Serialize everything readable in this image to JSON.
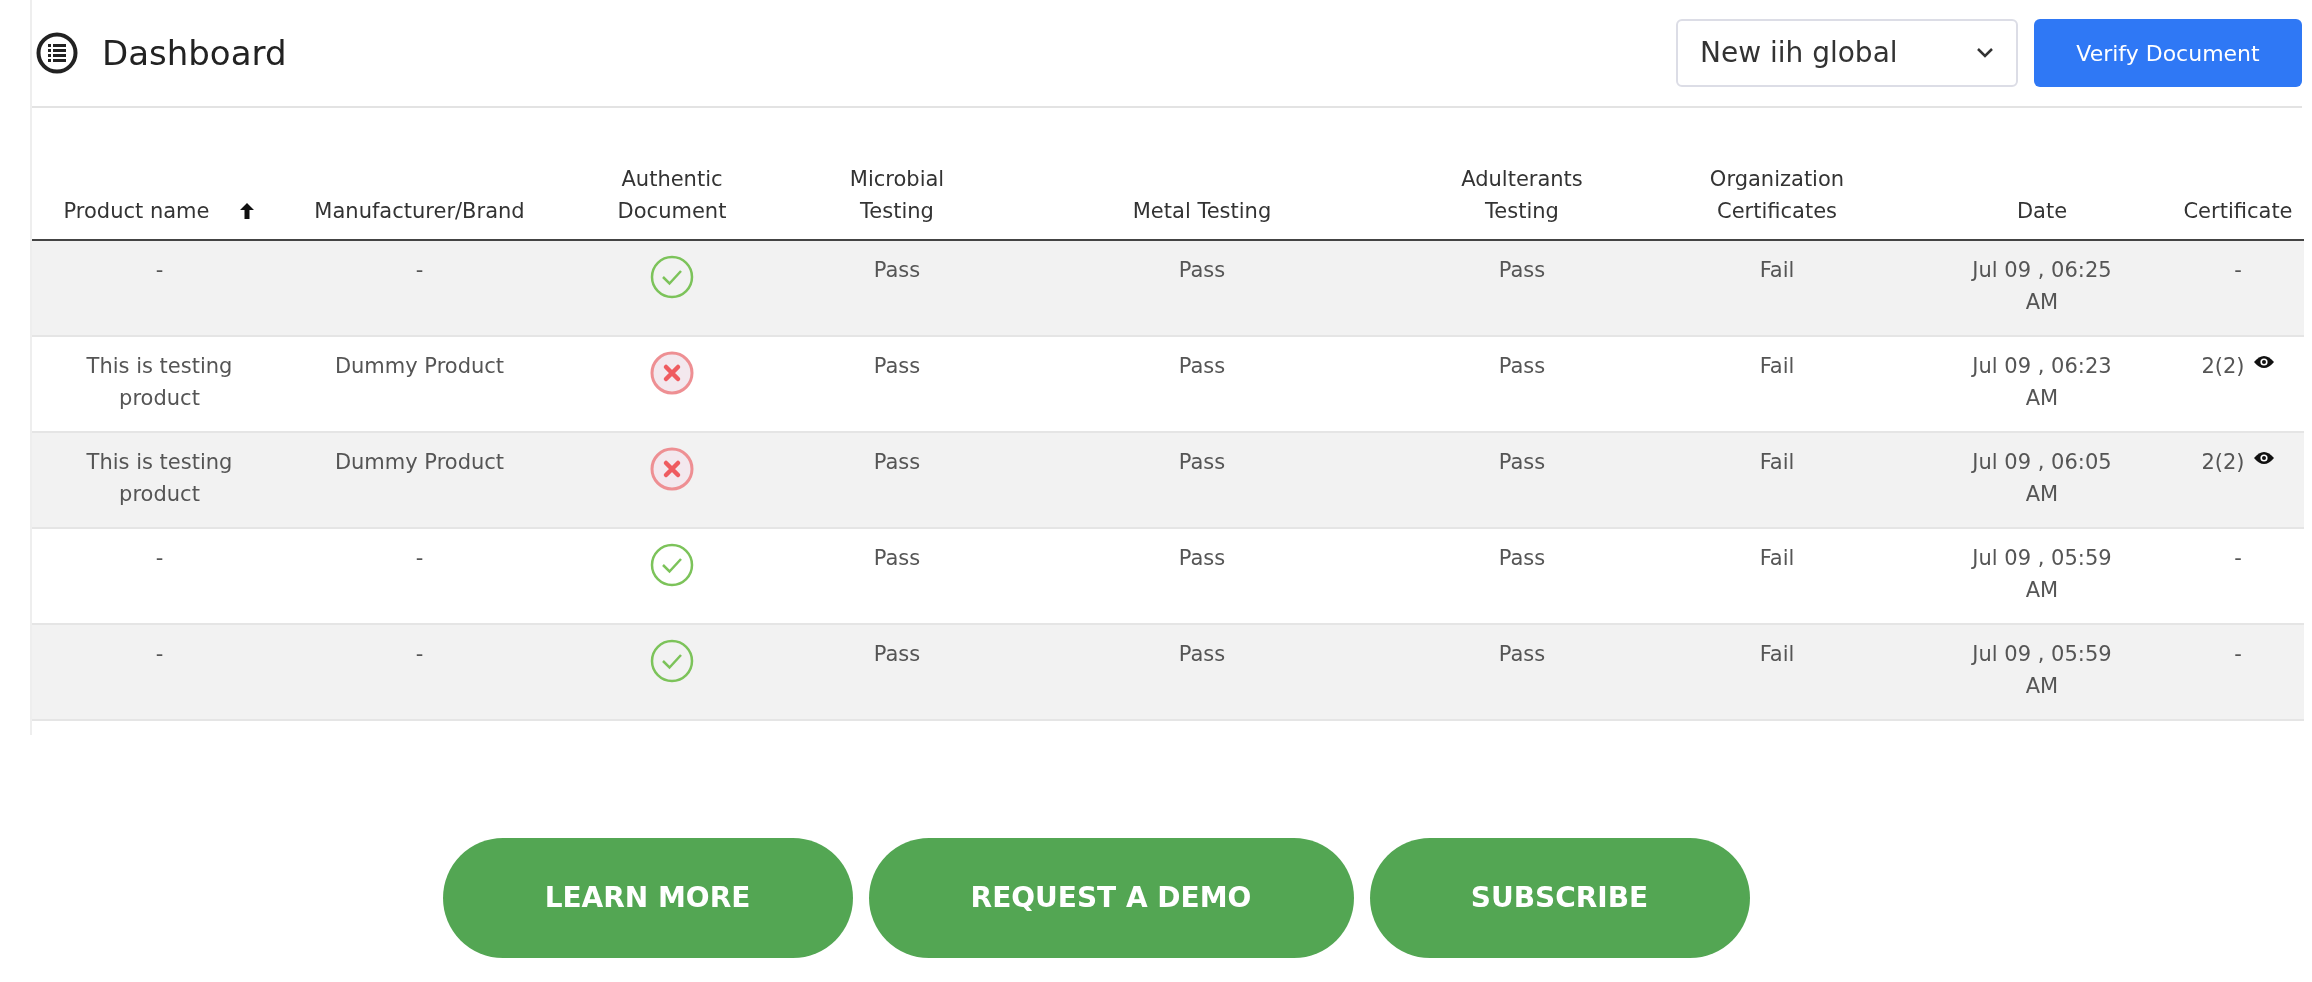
{
  "header": {
    "title": "Dashboard",
    "organization_select": {
      "value": "New iih global"
    },
    "verify_button": "Verify Document"
  },
  "table": {
    "columns": [
      {
        "label": "Product name",
        "sorted": true
      },
      {
        "label": "Manufacturer/Brand",
        "sorted": false
      },
      {
        "label": "Authentic Document",
        "sorted": false
      },
      {
        "label": "Microbial Testing",
        "sorted": false
      },
      {
        "label": "Metal Testing",
        "sorted": false
      },
      {
        "label": "Adulterants Testing",
        "sorted": false
      },
      {
        "label": "Organization Certificates",
        "sorted": false
      },
      {
        "label": "Date",
        "sorted": false
      },
      {
        "label": "Certificate",
        "sorted": false
      }
    ],
    "rows": [
      {
        "product": "-",
        "brand": "-",
        "authentic": true,
        "microbial": "Pass",
        "metal": "Pass",
        "adulterants": "Pass",
        "org_certificates": "Fail",
        "date": "Jul 09 , 06:25 AM",
        "certificate": {
          "text": "-",
          "viewable": false
        }
      },
      {
        "product": "This is testing product",
        "brand": "Dummy Product",
        "authentic": false,
        "microbial": "Pass",
        "metal": "Pass",
        "adulterants": "Pass",
        "org_certificates": "Fail",
        "date": "Jul 09 , 06:23 AM",
        "certificate": {
          "text": "2(2)",
          "viewable": true
        }
      },
      {
        "product": "This is testing product",
        "brand": "Dummy Product",
        "authentic": false,
        "microbial": "Pass",
        "metal": "Pass",
        "adulterants": "Pass",
        "org_certificates": "Fail",
        "date": "Jul 09 , 06:05 AM",
        "certificate": {
          "text": "2(2)",
          "viewable": true
        }
      },
      {
        "product": "-",
        "brand": "-",
        "authentic": true,
        "microbial": "Pass",
        "metal": "Pass",
        "adulterants": "Pass",
        "org_certificates": "Fail",
        "date": "Jul 09 , 05:59 AM",
        "certificate": {
          "text": "-",
          "viewable": false
        }
      },
      {
        "product": "-",
        "brand": "-",
        "authentic": true,
        "microbial": "Pass",
        "metal": "Pass",
        "adulterants": "Pass",
        "org_certificates": "Fail",
        "date": "Jul 09 , 05:59 AM",
        "certificate": {
          "text": "-",
          "viewable": false
        }
      }
    ]
  },
  "cta_buttons": [
    "LEARN MORE",
    "REQUEST A DEMO",
    "SUBSCRIBE"
  ]
}
